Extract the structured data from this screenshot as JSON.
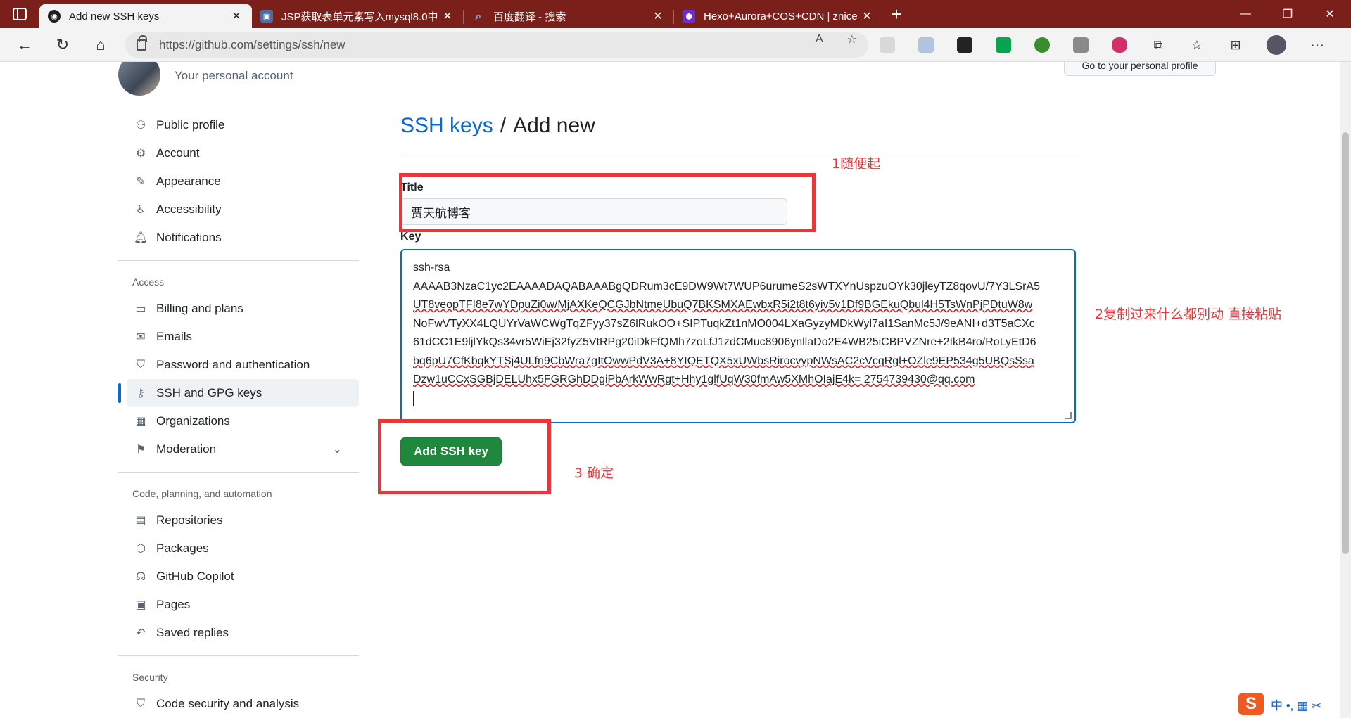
{
  "browser": {
    "tabs": [
      {
        "title": "Add new SSH keys",
        "active": true,
        "favicon": "github-icon"
      },
      {
        "title": "JSP获取表单元素写入mysql8.0中",
        "active": false,
        "favicon": "blog-icon"
      },
      {
        "title": "百度翻译 - 搜索",
        "active": false,
        "favicon": "search-icon"
      },
      {
        "title": "Hexo+Aurora+COS+CDN | znice",
        "active": false,
        "favicon": "hexo-icon"
      }
    ],
    "url": "https://github.com/settings/ssh/new",
    "window_controls": {
      "minimize": "—",
      "restore": "❐",
      "close": "✕"
    }
  },
  "header": {
    "subtitle": "Your personal account",
    "go_profile_label": "Go to your personal profile"
  },
  "sidebar": {
    "groups": [
      {
        "heading": "",
        "items": [
          {
            "label": "Public profile",
            "icon": "person-icon"
          },
          {
            "label": "Account",
            "icon": "gear-icon"
          },
          {
            "label": "Appearance",
            "icon": "paintbrush-icon"
          },
          {
            "label": "Accessibility",
            "icon": "accessibility-icon"
          },
          {
            "label": "Notifications",
            "icon": "bell-icon"
          }
        ]
      },
      {
        "heading": "Access",
        "items": [
          {
            "label": "Billing and plans",
            "icon": "credit-card-icon"
          },
          {
            "label": "Emails",
            "icon": "mail-icon"
          },
          {
            "label": "Password and authentication",
            "icon": "shield-lock-icon"
          },
          {
            "label": "SSH and GPG keys",
            "icon": "key-icon",
            "active": true
          },
          {
            "label": "Organizations",
            "icon": "organization-icon"
          },
          {
            "label": "Moderation",
            "icon": "report-icon",
            "expandable": true
          }
        ]
      },
      {
        "heading": "Code, planning, and automation",
        "items": [
          {
            "label": "Repositories",
            "icon": "repo-icon"
          },
          {
            "label": "Packages",
            "icon": "package-icon"
          },
          {
            "label": "GitHub Copilot",
            "icon": "copilot-icon"
          },
          {
            "label": "Pages",
            "icon": "browser-icon"
          },
          {
            "label": "Saved replies",
            "icon": "reply-icon"
          }
        ]
      },
      {
        "heading": "Security",
        "items": [
          {
            "label": "Code security and analysis",
            "icon": "shield-icon"
          }
        ]
      }
    ]
  },
  "main": {
    "breadcrumb_link": "SSH keys",
    "breadcrumb_sep": "/",
    "breadcrumb_current": "Add new",
    "title_label": "Title",
    "title_value": "贾天航博客",
    "key_label": "Key",
    "key_lines": [
      "ssh-rsa",
      "AAAAB3NzaC1yc2EAAAADAQABAAABgQDRum3cE9DW9Wt7WUP6urumeS2sWTXYnUspzuOYk30jleyTZ8qovU/7Y3LSrA5",
      "UT8veopTFI8e7wYDpuZi0w/MjAXKeQCGJbNtmeUbuQ7BKSMXAEwbxR5i2t8t6yiv5v1Df9BGEkuQbul4H5TsWnPjPDtuW8w",
      "NoFwVTyXX4LQUYrVaWCWgTqZFyy37sZ6lRukOO+SIPTuqkZt1nMO004LXaGyzyMDkWyl7aI1SanMc5J/9eANI+d3T5aCXc",
      "61dCC1E9ljlYkQs34vr5WiEj32fyZ5VtRPg20iDkFfQMh7zoLfJ1zdCMuc8906ynllaDo2E4WB25iCBPVZNre+2IkB4ro/RoLyEtD6",
      "bq6pU7CfKbqkYTSj4ULfn9CbWra7gItOwwPdV3A+8YIQETQX5xUWbsRirocvypNWsAC2cVcqRgl+OZle9EP534g5UBQsSsa",
      "Dzw1uCCxSGBjDELUhx5FGRGhDDgiPbArkWwRgt+Hhy1glfUqW30fmAw5XMhOIajE4k= 2754739430@qq.com"
    ],
    "submit_label": "Add SSH key"
  },
  "annotations": {
    "step1": "1随便起",
    "step2": "2复制过来什么都别动  直接粘贴",
    "step3": "3 确定"
  },
  "ime": {
    "logo": "S",
    "text": "中 •, ▦ ✂"
  },
  "colors": {
    "tabbar": "#7a1f1a",
    "link": "#0969da",
    "primary_button": "#1f883d",
    "annotation": "#e8363a"
  }
}
